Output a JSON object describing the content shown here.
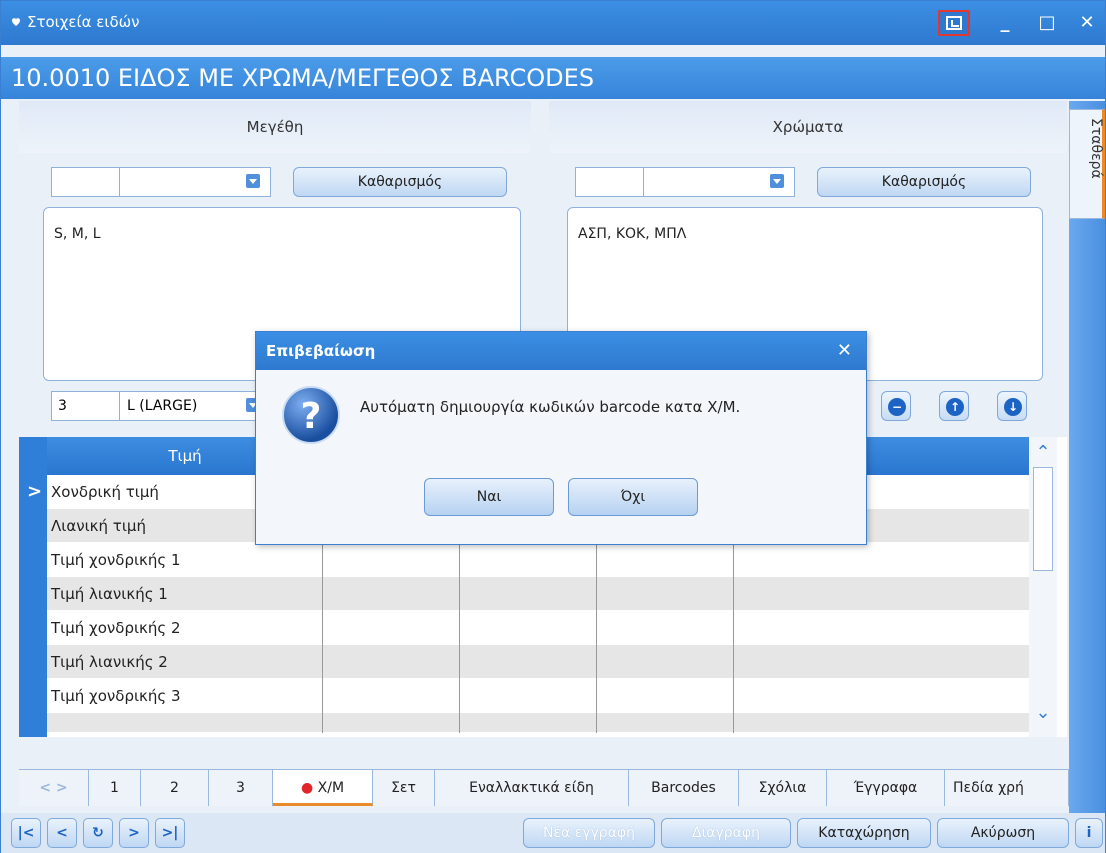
{
  "window": {
    "title": "Στοιχεία ειδών",
    "item_title": "10.0010 ΕΙΔΟΣ ΜΕ ΧΡΩΜΑ/ΜΕΓΕΘΟΣ BARCODES",
    "side_tab": "Σταθερά"
  },
  "sizes": {
    "header": "Μεγέθη",
    "combo_code": "",
    "combo_name": "",
    "clear_label": "Καθαρισμός",
    "text": "S, M, L",
    "current_code": "3",
    "current_name": "L (LARGE)"
  },
  "colors": {
    "header": "Χρώματα",
    "combo_code": "",
    "combo_name": "",
    "clear_label": "Καθαρισμός",
    "text": "ΑΣΠ, ΚΟΚ, ΜΠΛ"
  },
  "grid": {
    "header_col1": "Τιμή",
    "rows": [
      "Χονδρική τιμή",
      "Λιανική τιμή",
      "Τιμή χονδρικής 1",
      "Τιμή λιανικής 1",
      "Τιμή χονδρικής 2",
      "Τιμή λιανικής 2",
      "Τιμή χονδρικής 3",
      ""
    ]
  },
  "tabs": [
    "1",
    "2",
    "3",
    "Χ/Μ",
    "Σετ",
    "Εναλλακτικά είδη",
    "Barcodes",
    "Σχόλια",
    "Έγγραφα",
    "Πεδία χρή"
  ],
  "actions": {
    "new_record": "Νέα εγγραφή",
    "delete": "Διαγραφή",
    "save": "Καταχώρηση",
    "cancel": "Ακύρωση",
    "info": "i"
  },
  "dialog": {
    "title": "Επιβεβαίωση",
    "message": "Αυτόματη δημιουργία κωδικών barcode κατα Χ/Μ.",
    "yes": "Ναι",
    "no": "Όχι"
  }
}
